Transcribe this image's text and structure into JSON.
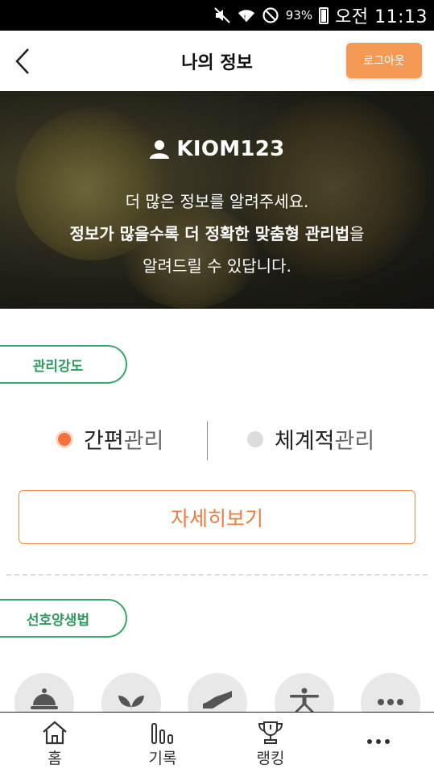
{
  "status_bar": {
    "battery": "93%",
    "time": "오전 11:13",
    "icons": [
      "mute-icon",
      "wifi-icon",
      "no-signal-icon",
      "battery-icon"
    ]
  },
  "header": {
    "title": "나의 정보",
    "logout_label": "로그아웃",
    "back_icon": "back-chevron-icon"
  },
  "hero": {
    "username": "KIOM123",
    "line1": "더 많은 정보를 알려주세요.",
    "line2_bold": "정보가 많을수록 더 정확한 맞춤형 관리법",
    "line2_tail": "을",
    "line3": "알려드릴 수 있답니다."
  },
  "management": {
    "section_label": "관리강도",
    "options": [
      {
        "strong": "간편",
        "light": "관리",
        "selected": true
      },
      {
        "strong": "체계적",
        "light": "관리",
        "selected": false
      }
    ],
    "detail_label": "자세히보기"
  },
  "preferred": {
    "section_label": "선호양생법",
    "items": [
      {
        "icon": "food-cloche-icon"
      },
      {
        "icon": "herb-leaf-icon"
      },
      {
        "icon": "hand-care-icon"
      },
      {
        "icon": "exercise-pose-icon"
      },
      {
        "icon": "more-dots-icon"
      }
    ]
  },
  "bottom_nav": {
    "items": [
      {
        "label": "홈",
        "icon": "home-icon"
      },
      {
        "label": "기록",
        "icon": "bar-chart-icon"
      },
      {
        "label": "랭킹",
        "icon": "trophy-icon"
      },
      {
        "label": "",
        "icon": "more-dots-icon"
      }
    ]
  },
  "colors": {
    "accent_orange": "#f59a55",
    "radio_orange": "#f3713a",
    "tag_green": "#36a86a",
    "icon_gray": "#555555"
  }
}
